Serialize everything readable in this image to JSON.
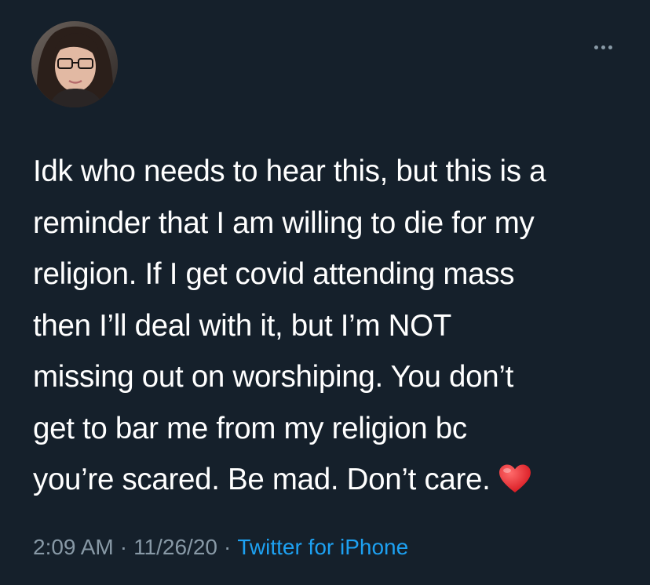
{
  "tweet": {
    "lines": [
      "Idk who needs to hear this, but this is a",
      "reminder that I am willing to die for my",
      "religion. If I get covid attending mass",
      "then I’ll deal with it, but I’m NOT",
      "missing out on worshiping. You don’t",
      "get to bar me from my religion bc",
      "you’re scared. Be mad. Don’t care."
    ],
    "emoji": "red-heart-emoji"
  },
  "meta": {
    "time": "2:09 AM",
    "separator": "·",
    "date": "11/26/20",
    "source": "Twitter for iPhone"
  },
  "icons": {
    "more": "more-options-icon",
    "avatar": "profile-avatar"
  },
  "colors": {
    "background": "#15202b",
    "text": "#ffffff",
    "secondary": "#8899a6",
    "link": "#1da1f2",
    "heart": "#e0245e"
  }
}
